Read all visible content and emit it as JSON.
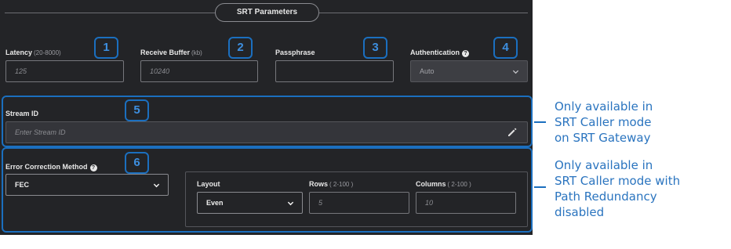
{
  "section": {
    "title": "SRT Parameters"
  },
  "fields": {
    "latency": {
      "label": "Latency",
      "hint": "(20-8000)",
      "placeholder": "125"
    },
    "receive_buffer": {
      "label": "Receive Buffer",
      "hint": "(kb)",
      "placeholder": "10240"
    },
    "passphrase": {
      "label": "Passphrase",
      "placeholder": ""
    },
    "authentication": {
      "label": "Authentication",
      "help_icon": "?",
      "value": "Auto"
    },
    "stream_id": {
      "label": "Stream ID",
      "placeholder": "Enter Stream ID"
    },
    "error_correction": {
      "label": "Error Correction Method",
      "help_icon": "?",
      "value": "FEC"
    },
    "layout": {
      "label": "Layout",
      "value": "Even"
    },
    "rows": {
      "label": "Rows",
      "hint": "( 2-100 )",
      "placeholder": "5"
    },
    "columns": {
      "label": "Columns",
      "hint": "( 2-100 )",
      "placeholder": "10"
    }
  },
  "badges": [
    "1",
    "2",
    "3",
    "4",
    "5",
    "6"
  ],
  "annotations": {
    "stream_id_note": [
      "Only available in",
      "SRT Caller mode",
      "on SRT Gateway"
    ],
    "fec_note": [
      "Only available in",
      "SRT Caller mode with",
      "Path Redundancy",
      "disabled"
    ]
  },
  "colors": {
    "panel_bg": "#232427",
    "highlight": "#1b6fbf",
    "note_text": "#2a74bf"
  },
  "icons": {
    "edit": "pencil-icon",
    "dropdown": "chevron-down-icon",
    "help": "question-circle-icon"
  }
}
